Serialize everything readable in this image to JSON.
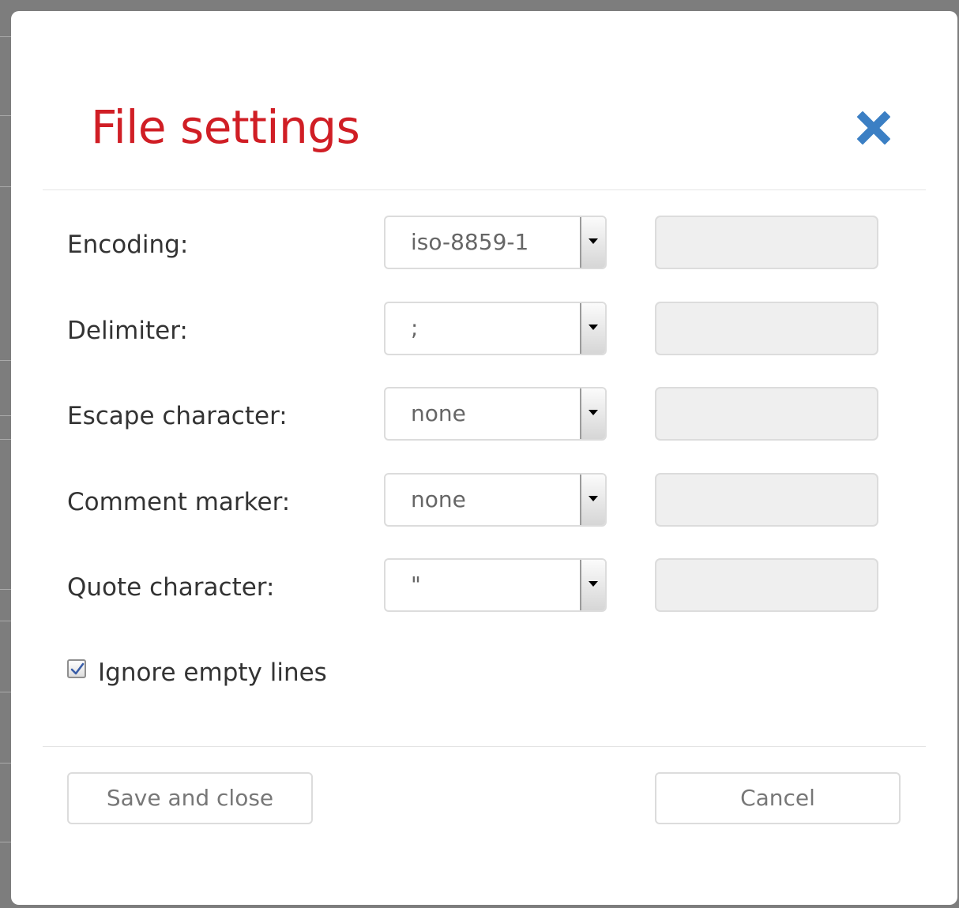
{
  "dialog": {
    "title": "File settings",
    "title_color": "#d01e25",
    "close_icon": "close-icon",
    "close_color": "#3b7fc4"
  },
  "fields": [
    {
      "label": "Encoding:",
      "value": "iso-8859-1"
    },
    {
      "label": "Delimiter:",
      "value": ";"
    },
    {
      "label": "Escape character:",
      "value": "none"
    },
    {
      "label": "Comment marker:",
      "value": "none"
    },
    {
      "label": "Quote character:",
      "value": "\""
    }
  ],
  "options": {
    "ignore_empty_lines_label": "Ignore empty lines",
    "ignore_empty_lines_checked": true
  },
  "footer": {
    "save_label": "Save and close",
    "cancel_label": "Cancel"
  }
}
